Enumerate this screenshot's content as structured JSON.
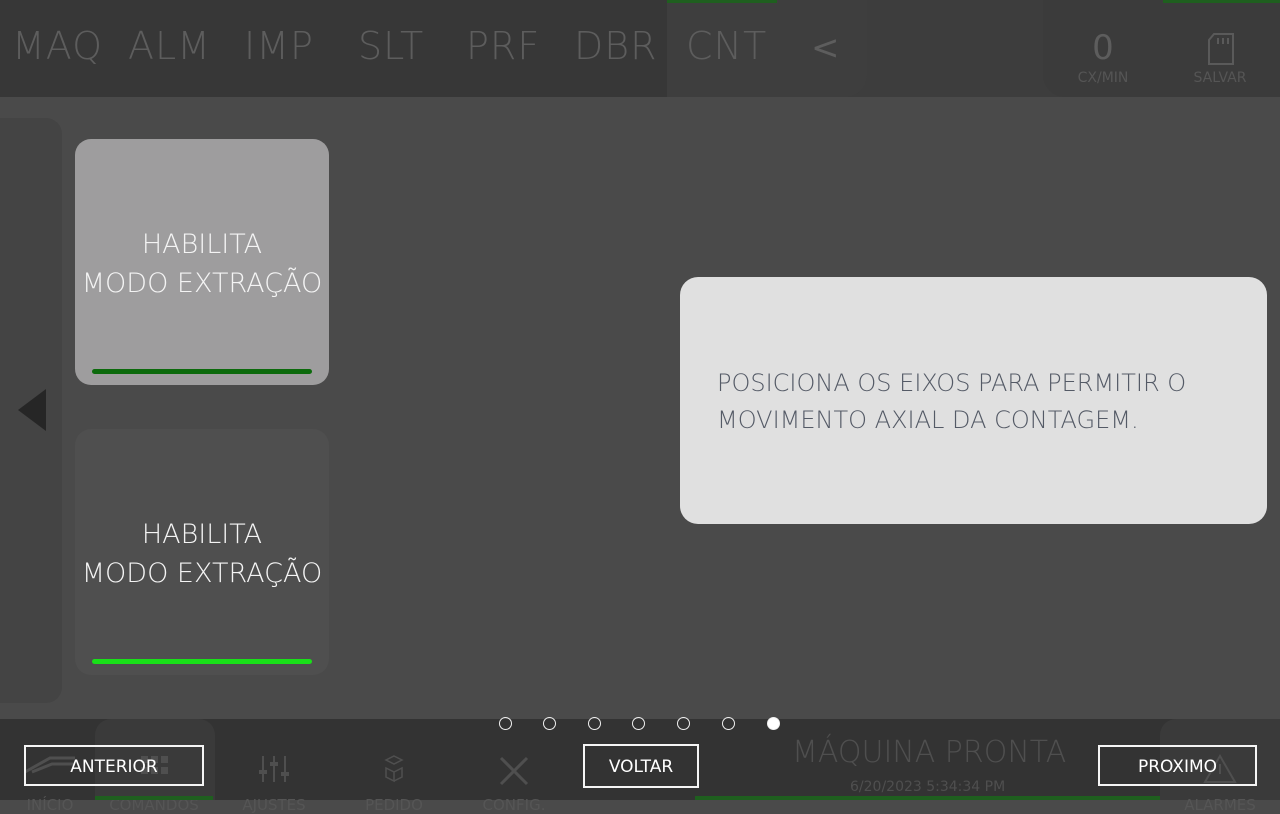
{
  "topbar": {
    "tabs": [
      "MAQ",
      "ALM",
      "IMP",
      "SLT",
      "PRF",
      "DBR",
      "CNT"
    ],
    "back_symbol": "<",
    "rate_value": "0",
    "rate_unit": "CX/MIN",
    "save_label": "SALVAR"
  },
  "tiles": [
    {
      "label": "HABILITA\nMODO EXTRAÇÃO",
      "state": "pressed",
      "bar_color": "#0c6a0c"
    },
    {
      "label": "HABILITA\nMODO EXTRAÇÃO",
      "state": "idle",
      "bar_color": "#19e019"
    }
  ],
  "info": {
    "text": "POSICIONA OS EIXOS PARA PERMITIR O MOVIMENTO AXIAL DA CONTAGEM."
  },
  "bottombar": {
    "nav": [
      "INÍCIO",
      "COMANDOS",
      "AJUSTES",
      "PEDIDO",
      "CONFIG.",
      "ALARMES"
    ],
    "status_title": "MÁQUINA PRONTA",
    "status_time": "6/20/2023 5:34:34 PM"
  },
  "pager": {
    "count": 7,
    "active_index": 6
  },
  "overlay": {
    "prev_label": "ANTERIOR",
    "back_label": "VOLTAR",
    "next_label": "PROXIMO"
  },
  "colors": {
    "accent_green": "#19e019",
    "dark_green": "#0c6a0c",
    "info_bg": "#e0e0e0",
    "info_text": "#545a66"
  }
}
